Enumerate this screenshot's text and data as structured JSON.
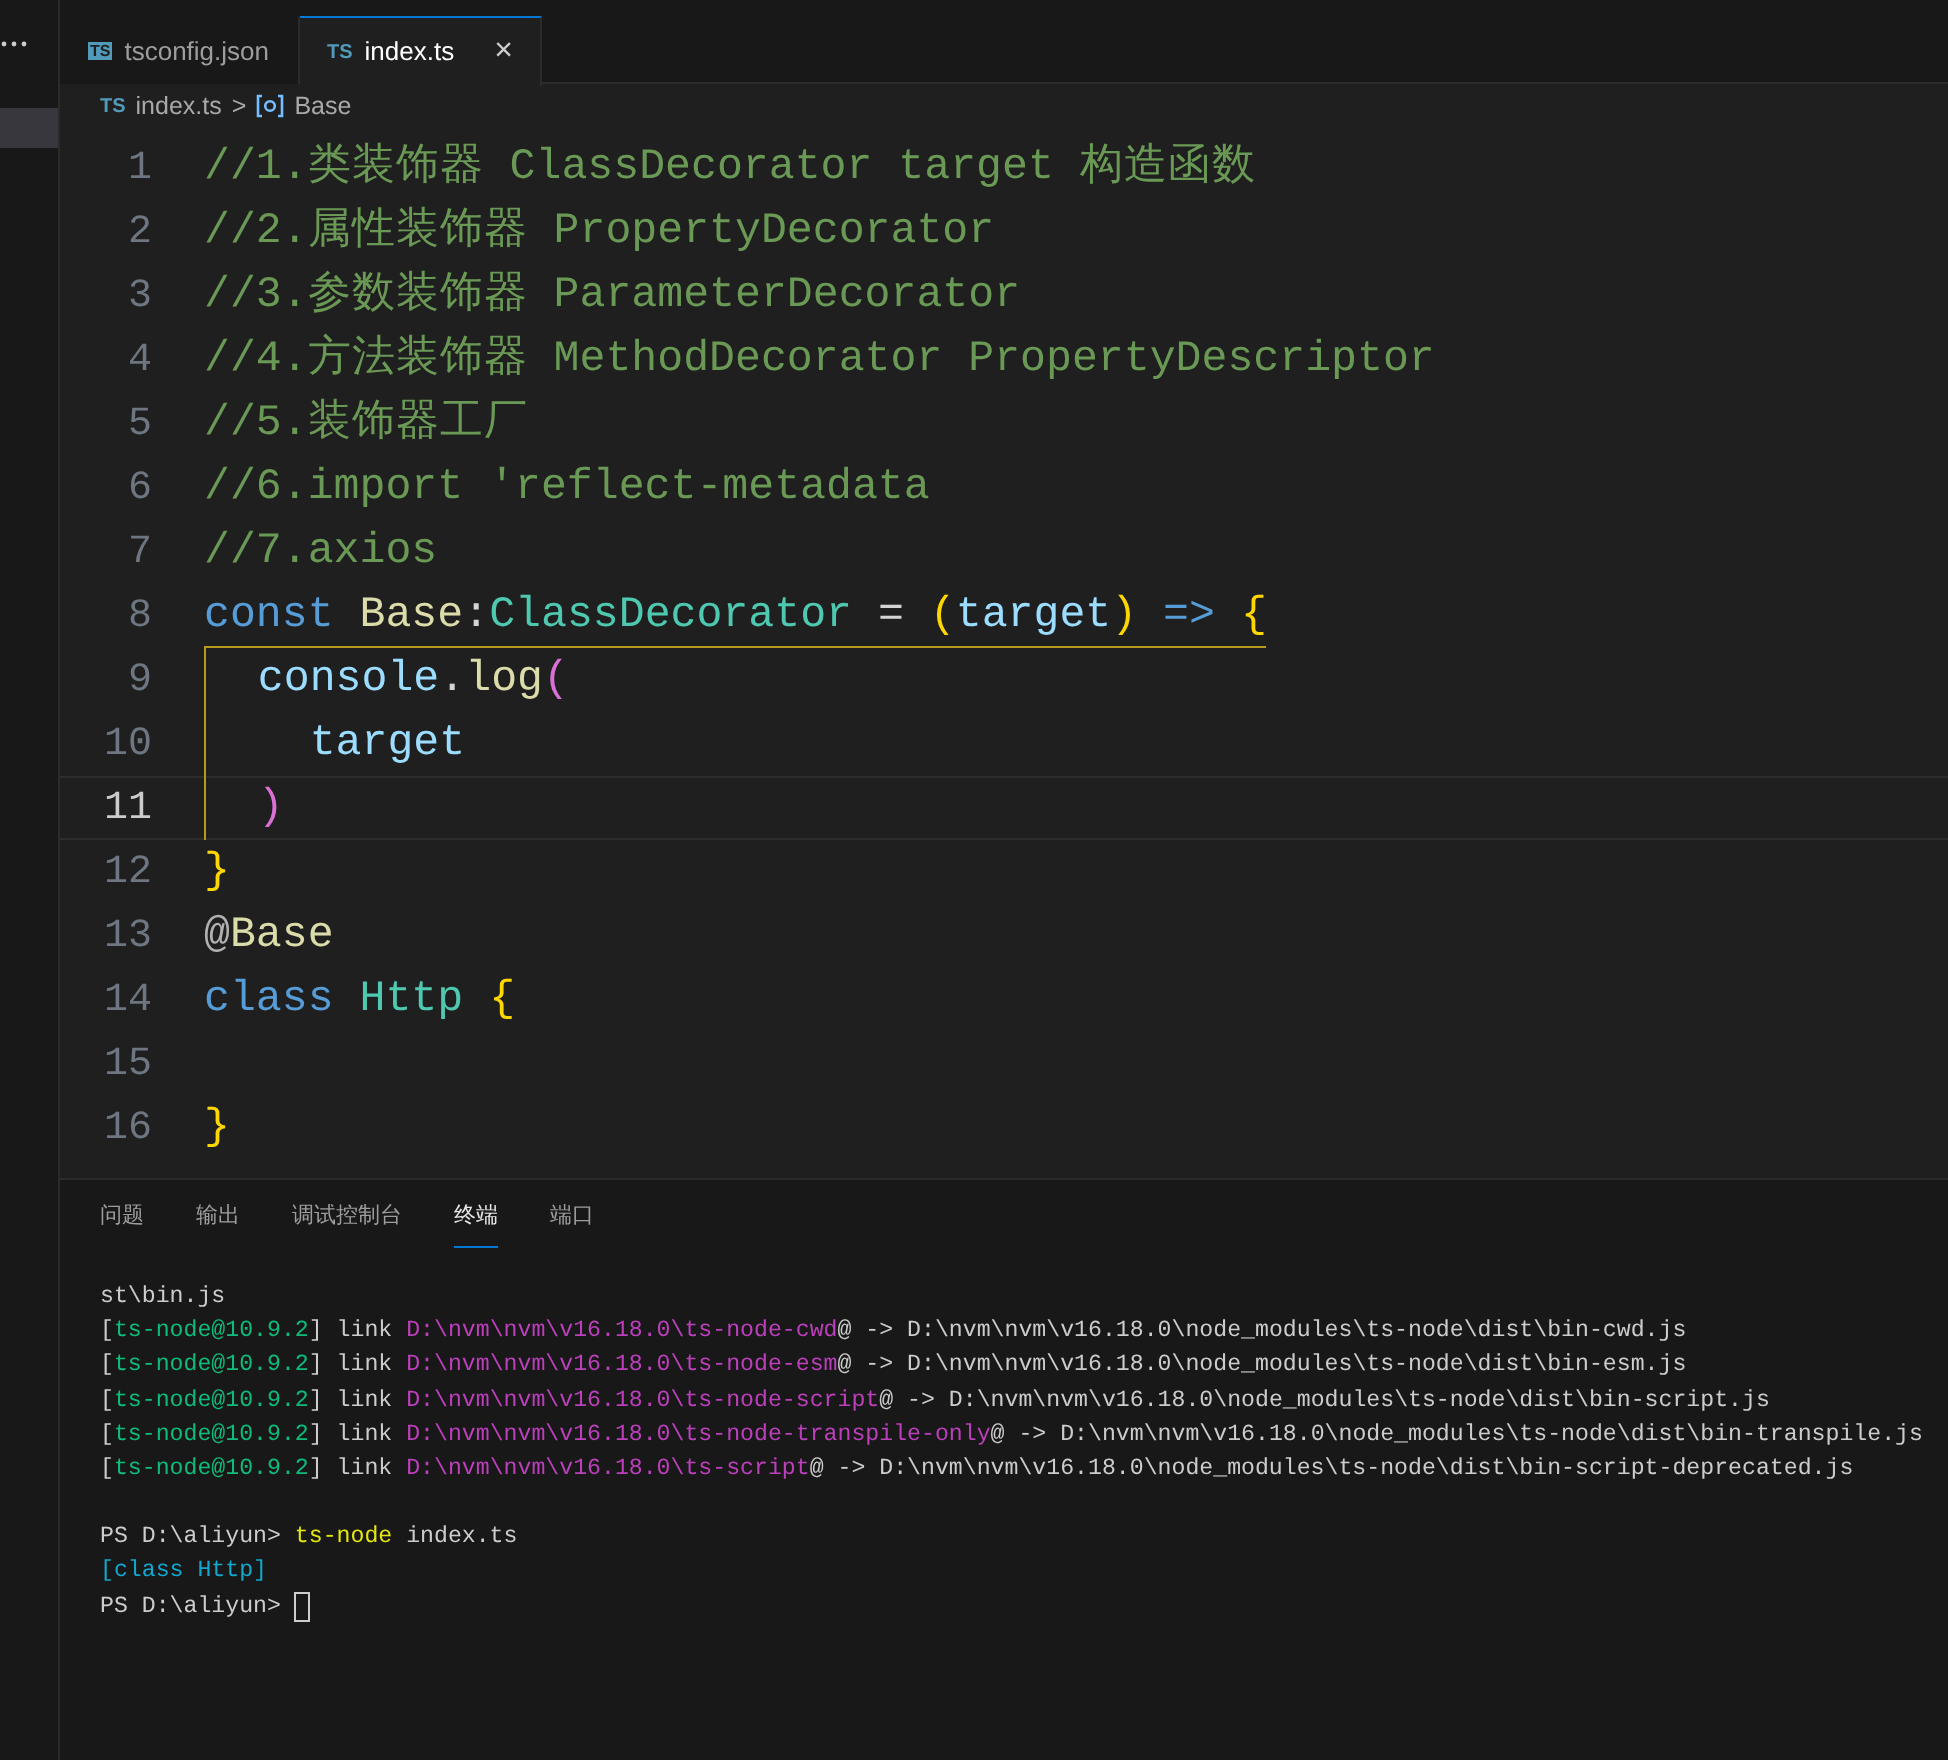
{
  "tabs": [
    {
      "label": "tsconfig.json",
      "icon": "TS",
      "selected": false
    },
    {
      "label": "index.ts",
      "icon": "TS",
      "selected": true,
      "close": "×"
    }
  ],
  "breadcrumb": {
    "file_icon": "TS",
    "file": "index.ts",
    "separator": ">",
    "symbol": "Base"
  },
  "code_lines": [
    {
      "number": "1",
      "tokens": [
        {
          "kind": "comment",
          "text": "//1.类装饰器 ClassDecorator target 构造函数"
        }
      ]
    },
    {
      "number": "2",
      "tokens": [
        {
          "kind": "comment",
          "text": "//2.属性装饰器 PropertyDecorator"
        }
      ]
    },
    {
      "number": "3",
      "tokens": [
        {
          "kind": "comment",
          "text": "//3.参数装饰器 ParameterDecorator"
        }
      ]
    },
    {
      "number": "4",
      "tokens": [
        {
          "kind": "comment",
          "text": "//4.方法装饰器 MethodDecorator PropertyDescriptor"
        }
      ]
    },
    {
      "number": "5",
      "tokens": [
        {
          "kind": "comment",
          "text": "//5.装饰器工厂"
        }
      ]
    },
    {
      "number": "6",
      "tokens": [
        {
          "kind": "comment",
          "text": "//6.import 'reflect-metadata"
        }
      ]
    },
    {
      "number": "7",
      "tokens": [
        {
          "kind": "comment",
          "text": "//7.axios"
        }
      ]
    },
    {
      "number": "8",
      "guide_start": true,
      "tokens": [
        {
          "kind": "keyword",
          "text": "const "
        },
        {
          "kind": "func",
          "text": "Base"
        },
        {
          "kind": "plain",
          "text": ":"
        },
        {
          "kind": "type",
          "text": "ClassDecorator"
        },
        {
          "kind": "plain",
          "text": " = "
        },
        {
          "kind": "bracket",
          "text": "("
        },
        {
          "kind": "var",
          "text": "target"
        },
        {
          "kind": "bracket",
          "text": ")"
        },
        {
          "kind": "keyword",
          "text": " => "
        },
        {
          "kind": "bracket",
          "text": "{"
        }
      ]
    },
    {
      "number": "9",
      "in_guide": true,
      "tokens": [
        {
          "kind": "var",
          "text": "  console"
        },
        {
          "kind": "plain",
          "text": "."
        },
        {
          "kind": "func",
          "text": "log"
        },
        {
          "kind": "paren",
          "text": "("
        }
      ]
    },
    {
      "number": "10",
      "in_guide": true,
      "tokens": [
        {
          "kind": "var",
          "text": "    target"
        }
      ]
    },
    {
      "number": "11",
      "in_guide": true,
      "active": true,
      "tokens": [
        {
          "kind": "paren",
          "text": "  )"
        }
      ]
    },
    {
      "number": "12",
      "tokens": [
        {
          "kind": "bracket",
          "text": "}"
        }
      ]
    },
    {
      "number": "13",
      "tokens": [
        {
          "kind": "muted",
          "text": "@"
        },
        {
          "kind": "func",
          "text": "Base"
        }
      ]
    },
    {
      "number": "14",
      "tokens": [
        {
          "kind": "keyword",
          "text": "class "
        },
        {
          "kind": "type",
          "text": "Http"
        },
        {
          "kind": "bracket",
          "text": " {"
        }
      ]
    },
    {
      "number": "15"
    },
    {
      "number": "16",
      "tokens": [
        {
          "kind": "bracket",
          "text": "}"
        }
      ]
    }
  ],
  "panel_tabs": [
    {
      "label": "问题",
      "selected": false
    },
    {
      "label": "输出",
      "selected": false
    },
    {
      "label": "调试控制台",
      "selected": false
    },
    {
      "label": "终端",
      "selected": true
    },
    {
      "label": "端口",
      "selected": false
    }
  ],
  "terminal_lines": [
    {
      "segments": [
        {
          "kind": "plain",
          "text": "st\\bin.js"
        }
      ]
    },
    {
      "segments": [
        {
          "kind": "plain",
          "text": "["
        },
        {
          "kind": "green",
          "text": "ts-node@10.9.2"
        },
        {
          "kind": "plain",
          "text": "] link "
        },
        {
          "kind": "purple",
          "text": "D:\\nvm\\nvm\\v16.18.0\\ts-node-cwd"
        },
        {
          "kind": "plain",
          "text": "@ -> D:\\nvm\\nvm\\v16.18.0\\node_modules\\ts-node\\dist\\bin-cwd.js"
        }
      ]
    },
    {
      "segments": [
        {
          "kind": "plain",
          "text": "["
        },
        {
          "kind": "green",
          "text": "ts-node@10.9.2"
        },
        {
          "kind": "plain",
          "text": "] link "
        },
        {
          "kind": "purple",
          "text": "D:\\nvm\\nvm\\v16.18.0\\ts-node-esm"
        },
        {
          "kind": "plain",
          "text": "@ -> D:\\nvm\\nvm\\v16.18.0\\node_modules\\ts-node\\dist\\bin-esm.js"
        }
      ]
    },
    {
      "segments": [
        {
          "kind": "plain",
          "text": "["
        },
        {
          "kind": "green",
          "text": "ts-node@10.9.2"
        },
        {
          "kind": "plain",
          "text": "] link "
        },
        {
          "kind": "purple",
          "text": "D:\\nvm\\nvm\\v16.18.0\\ts-node-script"
        },
        {
          "kind": "plain",
          "text": "@ -> D:\\nvm\\nvm\\v16.18.0\\node_modules\\ts-node\\dist\\bin-script.js"
        }
      ]
    },
    {
      "segments": [
        {
          "kind": "plain",
          "text": "["
        },
        {
          "kind": "green",
          "text": "ts-node@10.9.2"
        },
        {
          "kind": "plain",
          "text": "] link "
        },
        {
          "kind": "purple",
          "text": "D:\\nvm\\nvm\\v16.18.0\\ts-node-transpile-only"
        },
        {
          "kind": "plain",
          "text": "@ -> D:\\nvm\\nvm\\v16.18.0\\node_modules\\ts-node\\dist\\bin-transpile.js"
        }
      ]
    },
    {
      "segments": [
        {
          "kind": "plain",
          "text": "["
        },
        {
          "kind": "green",
          "text": "ts-node@10.9.2"
        },
        {
          "kind": "plain",
          "text": "] link "
        },
        {
          "kind": "purple",
          "text": "D:\\nvm\\nvm\\v16.18.0\\ts-script"
        },
        {
          "kind": "plain",
          "text": "@ -> D:\\nvm\\nvm\\v16.18.0\\node_modules\\ts-node\\dist\\bin-script-deprecated.js"
        }
      ]
    },
    {
      "gap_before": true,
      "segments": [
        {
          "kind": "plain",
          "text": "PS D:\\aliyun> "
        },
        {
          "kind": "yellow",
          "text": "ts-node"
        },
        {
          "kind": "plain",
          "text": " index.ts"
        }
      ]
    },
    {
      "segments": [
        {
          "kind": "cyan",
          "text": "[class Http]"
        }
      ]
    },
    {
      "cursor": true,
      "segments": [
        {
          "kind": "plain",
          "text": "PS D:\\aliyun> "
        }
      ]
    }
  ]
}
